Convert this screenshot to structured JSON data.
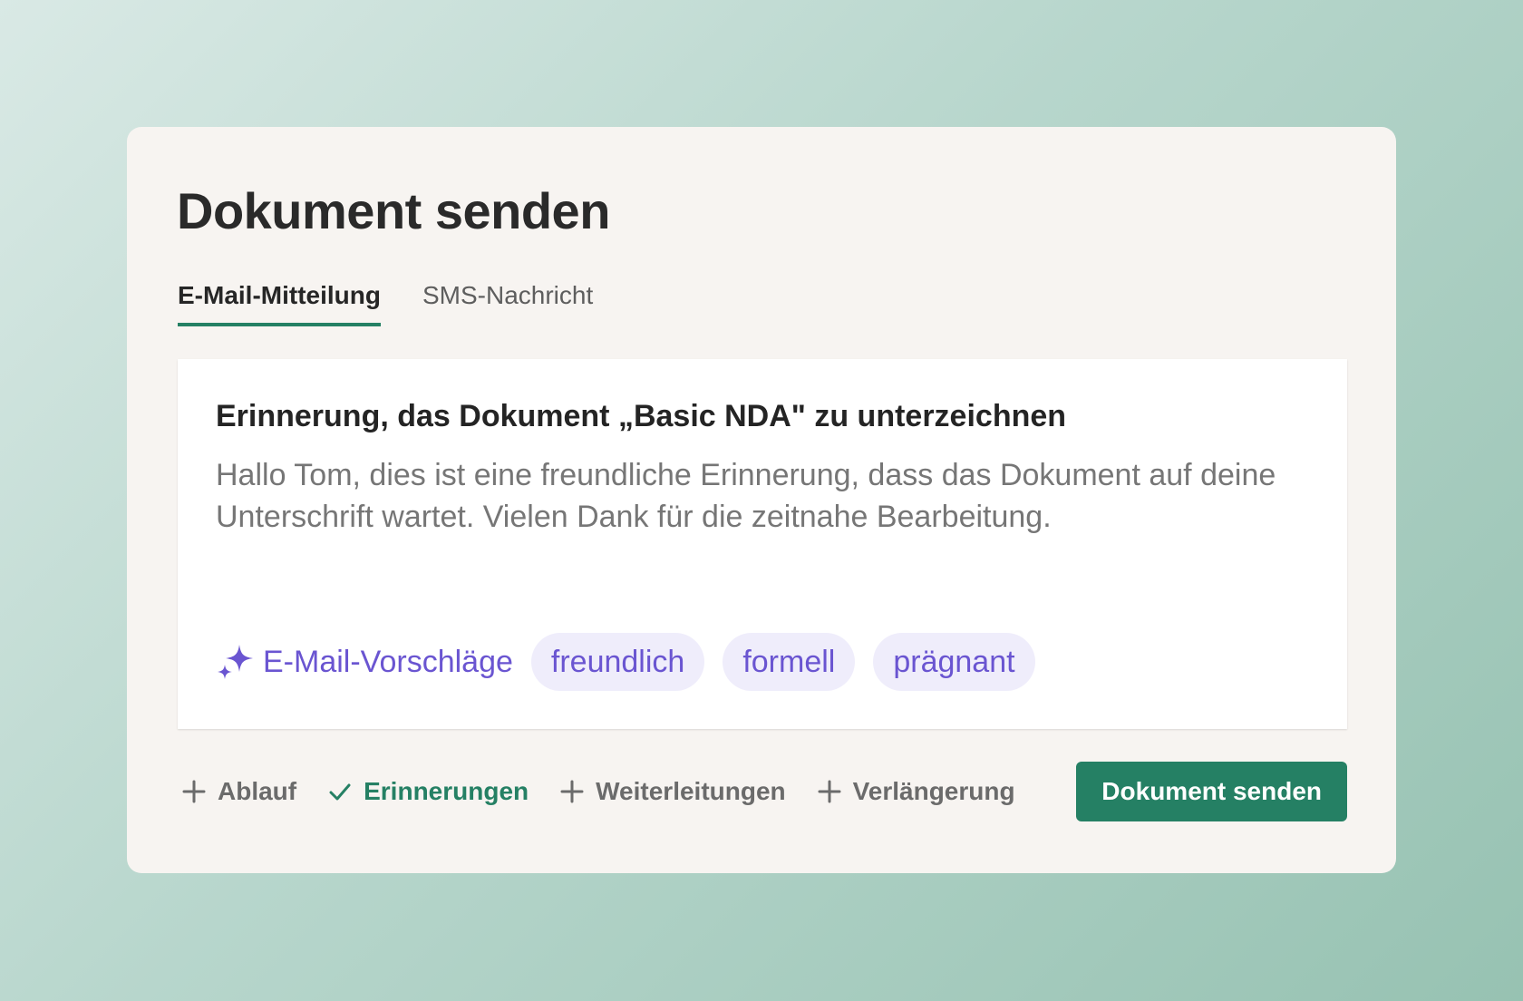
{
  "dialog": {
    "title": "Dokument senden"
  },
  "tabs": [
    {
      "label": "E-Mail-Mitteilung",
      "active": true
    },
    {
      "label": "SMS-Nachricht",
      "active": false
    }
  ],
  "message": {
    "subject": "Erinnerung, das Dokument „Basic NDA\" zu unterzeichnen",
    "body": "Hallo Tom, dies ist eine freundliche Erinnerung, dass das Dokument auf deine Unterschrift wartet. Vielen Dank für die zeitnahe Bearbeitung."
  },
  "suggestions": {
    "label": "E-Mail-Vorschläge",
    "icon": "sparkle-icon",
    "chips": [
      "freundlich",
      "formell",
      "prägnant"
    ]
  },
  "options": [
    {
      "label": "Ablauf",
      "icon": "plus-icon",
      "checked": false
    },
    {
      "label": "Erinnerungen",
      "icon": "check-icon",
      "checked": true
    },
    {
      "label": "Weiterleitungen",
      "icon": "plus-icon",
      "checked": false
    },
    {
      "label": "Verlängerung",
      "icon": "plus-icon",
      "checked": false
    }
  ],
  "actions": {
    "send_label": "Dokument senden"
  },
  "colors": {
    "accent_green": "#258064",
    "ai_purple": "#6a55d1",
    "chip_bg": "#efedfb",
    "card_bg": "#f7f4f1"
  }
}
